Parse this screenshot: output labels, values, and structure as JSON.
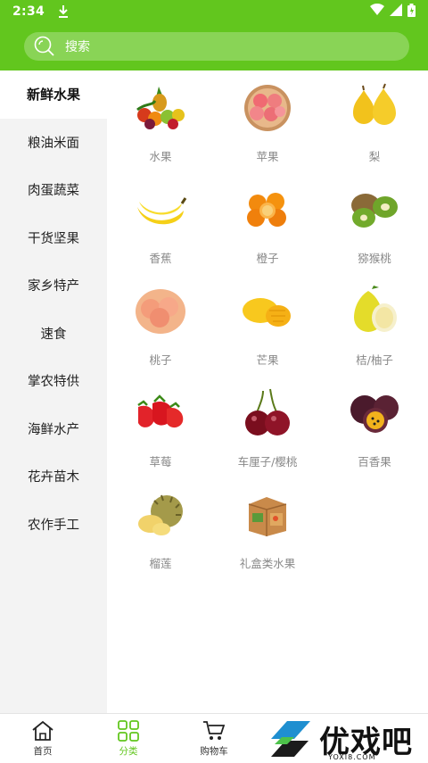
{
  "status": {
    "time": "2:34"
  },
  "search": {
    "placeholder": "搜索"
  },
  "sidebar": {
    "items": [
      {
        "label": "新鲜水果",
        "active": true
      },
      {
        "label": "粮油米面"
      },
      {
        "label": "肉蛋蔬菜"
      },
      {
        "label": "干货坚果"
      },
      {
        "label": "家乡特产"
      },
      {
        "label": "速食"
      },
      {
        "label": "掌农特供"
      },
      {
        "label": "海鲜水产"
      },
      {
        "label": "花卉苗木"
      },
      {
        "label": "农作手工"
      }
    ]
  },
  "categories": [
    {
      "label": "水果",
      "icon": "fruit-basket-icon"
    },
    {
      "label": "苹果",
      "icon": "apple-icon"
    },
    {
      "label": "梨",
      "icon": "pear-icon"
    },
    {
      "label": "香蕉",
      "icon": "banana-icon"
    },
    {
      "label": "橙子",
      "icon": "orange-icon"
    },
    {
      "label": "猕猴桃",
      "icon": "kiwi-icon"
    },
    {
      "label": "桃子",
      "icon": "peach-icon"
    },
    {
      "label": "芒果",
      "icon": "mango-icon"
    },
    {
      "label": "桔/柚子",
      "icon": "pomelo-icon"
    },
    {
      "label": "草莓",
      "icon": "strawberry-icon"
    },
    {
      "label": "车厘子/樱桃",
      "icon": "cherry-icon"
    },
    {
      "label": "百香果",
      "icon": "passion-fruit-icon"
    },
    {
      "label": "榴莲",
      "icon": "durian-icon"
    },
    {
      "label": "礼盒类水果",
      "icon": "gift-box-icon"
    }
  ],
  "bottom_nav": {
    "items": [
      {
        "label": "首页",
        "icon": "home-icon"
      },
      {
        "label": "分类",
        "icon": "category-icon",
        "active": true
      },
      {
        "label": "购物车",
        "icon": "cart-icon"
      }
    ]
  },
  "watermark": {
    "text": "优戏吧",
    "sub": "YOXI8.COM"
  },
  "colors": {
    "brand": "#62c61e",
    "sidebar_bg": "#f3f3f3",
    "label_gray": "#888888"
  }
}
